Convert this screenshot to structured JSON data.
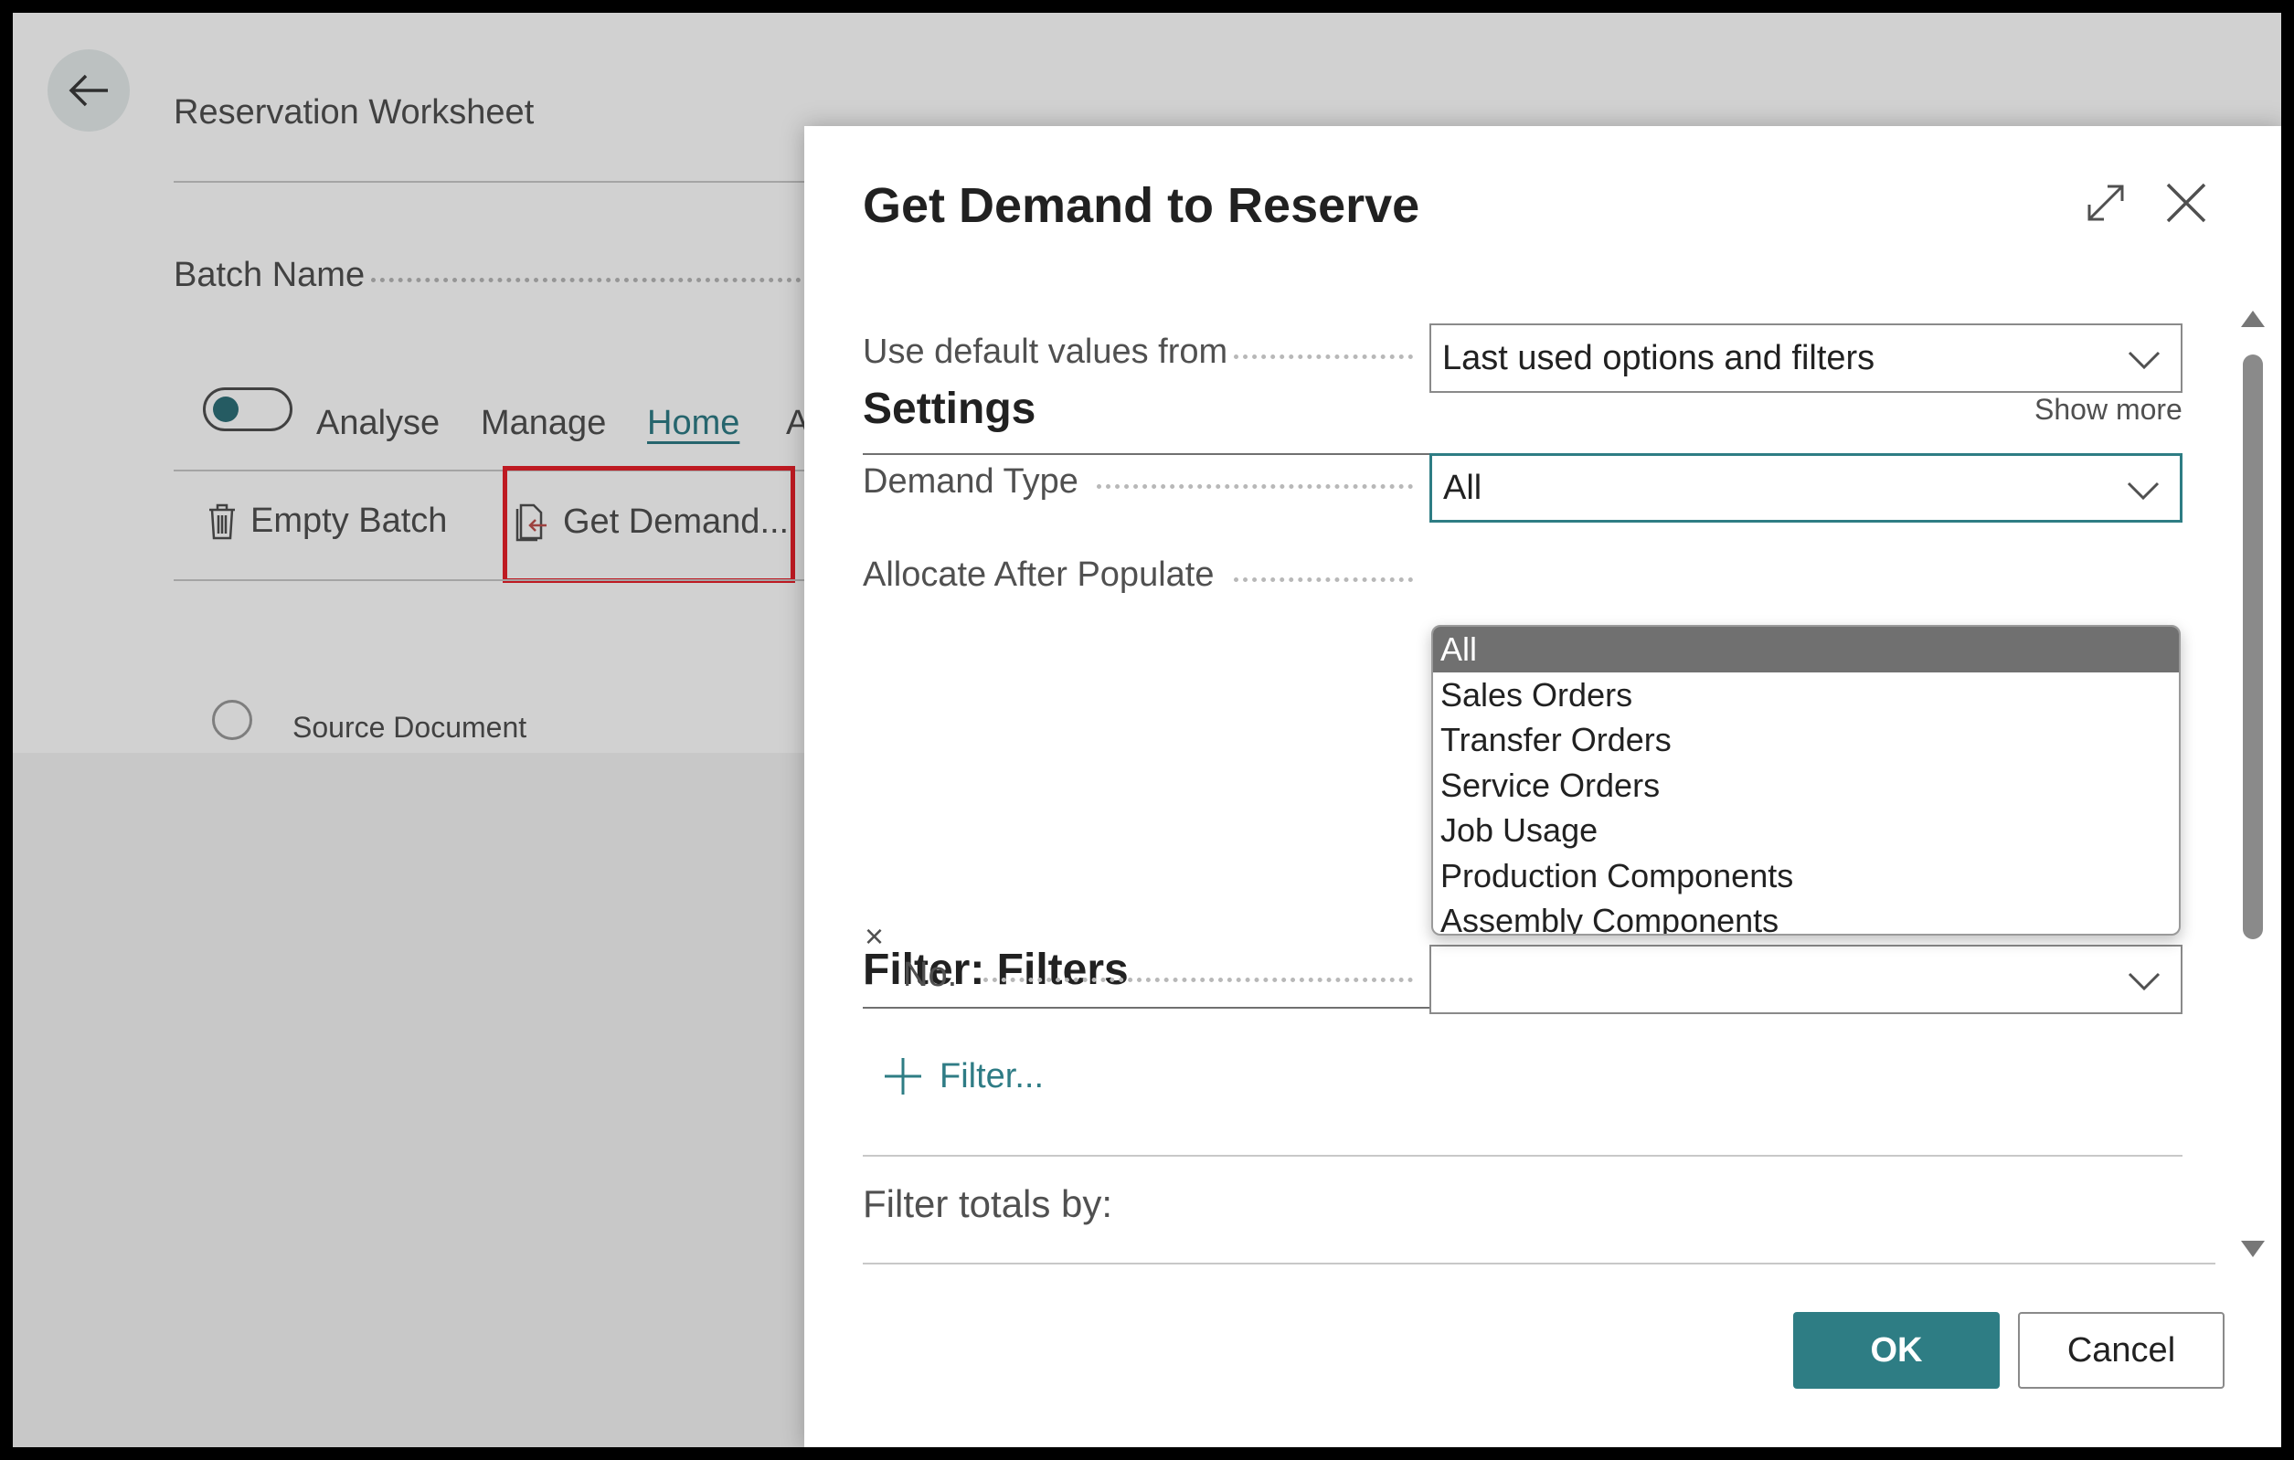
{
  "page": {
    "title": "Reservation Worksheet",
    "batch_label": "Batch Name",
    "nav": [
      "Analyse",
      "Manage",
      "Home",
      "A"
    ],
    "actions": {
      "empty_batch": "Empty Batch",
      "get_demand": "Get Demand..."
    },
    "column": "Source Document"
  },
  "dialog": {
    "title": "Get Demand to Reserve",
    "default_values_label": "Use default values from",
    "default_values_value": "Last used options and filters",
    "settings_title": "Settings",
    "show_more": "Show more",
    "demand_type_label": "Demand Type",
    "demand_type_value": "All",
    "allocate_label": "Allocate After Populate",
    "dropdown_options": [
      "All",
      "Sales Orders",
      "Transfer Orders",
      "Service Orders",
      "Job Usage",
      "Production Components",
      "Assembly Components"
    ],
    "filters_title": "Filter: Filters",
    "no_label": "No.",
    "remove_filter_glyph": "×",
    "add_filter": "Filter...",
    "totals_label": "Filter totals by:",
    "ok": "OK",
    "cancel": "Cancel"
  },
  "colors": {
    "accent": "#2e7d84",
    "highlight": "#e8202a"
  }
}
